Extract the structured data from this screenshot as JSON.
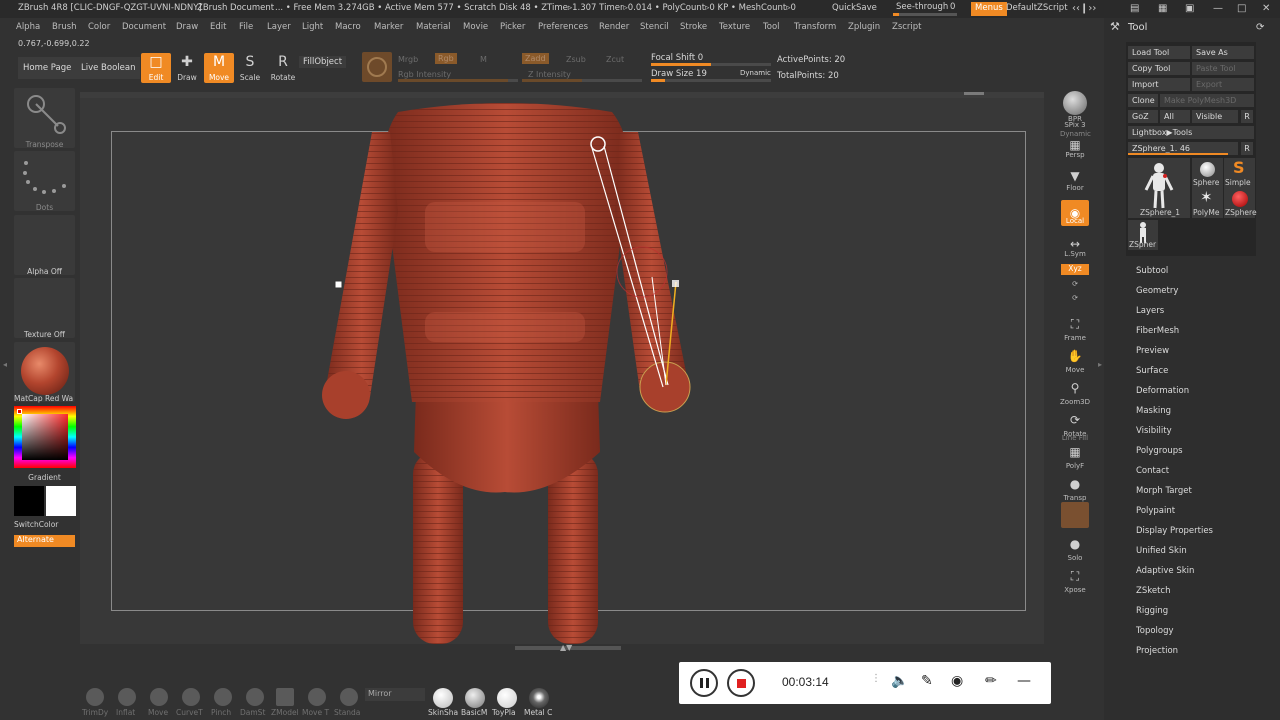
{
  "titlebar": {
    "app": "ZBrush 4R8 [CLIC-DNGF-QZGT-UVNI-NDNY]",
    "doc": "ZBrush Document",
    "stats": "... • Free Mem 3.274GB • Active Mem 577 • Scratch Disk 48 • ZTime▹1.307 Timer▹0.014 • PolyCount▹0 KP • MeshCount▹0",
    "quicksave": "QuickSave",
    "see_through": "See-through",
    "see_through_value": "0",
    "see_through_level": 0,
    "menus": "Menus",
    "script": "DefaultZScript"
  },
  "menubar": [
    "Alpha",
    "Brush",
    "Color",
    "Document",
    "Draw",
    "Edit",
    "File",
    "Layer",
    "Light",
    "Macro",
    "Marker",
    "Material",
    "Movie",
    "Picker",
    "Preferences",
    "Render",
    "Stencil",
    "Stroke",
    "Texture",
    "Tool",
    "Transform",
    "Zplugin",
    "Zscript"
  ],
  "coords": "0.767,-0.699,0.22",
  "toolbar": {
    "home_page": "Home Page",
    "live_boolean": "Live Boolean",
    "edit": "Edit",
    "draw": "Draw",
    "move": "Move",
    "scale": "Scale",
    "rotate": "Rotate",
    "fill_object": "FillObject",
    "mrgb": "Mrgb",
    "rgb": "Rgb",
    "m": "M",
    "rgb_intensity": "Rgb Intensity",
    "zadd": "Zadd",
    "zsub": "Zsub",
    "zcut": "Zcut",
    "z_intensity": "Z Intensity",
    "focal_shift": "Focal Shift 0",
    "draw_size": "Draw Size 19",
    "dynamic": "Dynamic",
    "active_points": "ActivePoints: 20",
    "total_points": "TotalPoints: 20"
  },
  "left_shelf": {
    "transpose": "Transpose",
    "dots": "Dots",
    "alpha_off": "Alpha Off",
    "texture_off": "Texture Off",
    "matcap": "MatCap Red Wa",
    "gradient": "Gradient",
    "switch_color": "SwitchColor",
    "alternate": "Alternate"
  },
  "right_shelf": [
    "BPR",
    "SPix 3",
    "Persp",
    "Floor",
    "Local",
    "L.Sym",
    "Frame",
    "Move",
    "Zoom3D",
    "Rotate",
    "PolyF",
    "Transp",
    "Solo",
    "Xpose"
  ],
  "right_shelf_extra": {
    "xyz": "Xyz",
    "dynamic": "Dynamic",
    "line_fill": "Line Fill"
  },
  "tool_panel": {
    "title": "Tool",
    "load_tool": "Load Tool",
    "save_as": "Save As",
    "copy_tool": "Copy Tool",
    "paste_tool": "Paste Tool",
    "import": "Import",
    "export": "Export",
    "clone": "Clone",
    "make_polymesh": "Make PolyMesh3D",
    "goz": "GoZ",
    "all": "All",
    "visible": "Visible",
    "r": "R",
    "lightbox_tools": "Lightbox▶Tools",
    "zsphere_slider": "ZSphere_1. 46",
    "thumbs": [
      "ZSphere_1",
      "Sphere",
      "Simple",
      "PolyMe",
      "ZSphere",
      "ZSpher"
    ],
    "subpalettes": [
      "Subtool",
      "Geometry",
      "Layers",
      "FiberMesh",
      "Preview",
      "Surface",
      "Deformation",
      "Masking",
      "Visibility",
      "Polygroups",
      "Contact",
      "Morph Target",
      "Polypaint",
      "Display Properties",
      "Unified Skin",
      "Adaptive Skin",
      "ZSketch",
      "Rigging",
      "Topology",
      "Projection"
    ]
  },
  "bottom": {
    "brushes": [
      "TrimDy",
      "Inflat",
      "Move",
      "CurveT",
      "Pinch",
      "DamSt",
      "ZModel",
      "Move T",
      "Standa"
    ],
    "mirror": "Mirror",
    "materials": [
      "SkinSha",
      "BasicM",
      "ToyPla",
      "Metal C"
    ]
  },
  "recorder": {
    "time": "00:03:14"
  },
  "colors": {
    "accent": "#f08a24",
    "model": "#b34a33"
  }
}
